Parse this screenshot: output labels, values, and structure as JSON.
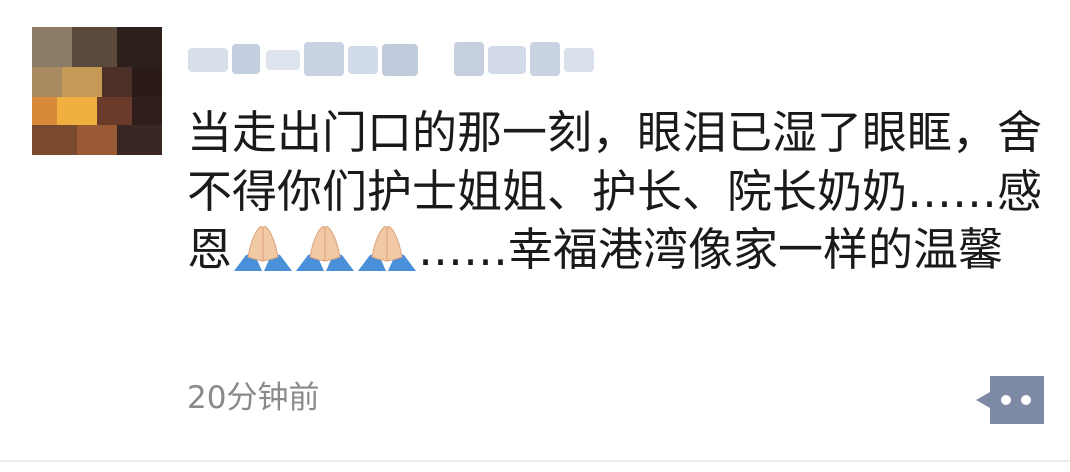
{
  "post": {
    "content_part1": "当走出门口的那一刻，眼泪已湿了眼眶，舍不得你们护士姐姐、护长、院长奶奶……感恩",
    "emojis": [
      "folded-hands-emoji",
      "folded-hands-emoji",
      "folded-hands-emoji"
    ],
    "content_part2": "……幸福港湾像家一样的温馨",
    "timestamp": "20分钟前"
  },
  "icons": {
    "avatar": "avatar-image-blurred",
    "username": "username-blurred",
    "more": "more-options-icon"
  },
  "colors": {
    "text": "#1a1a1a",
    "timestamp": "#8a8a8a",
    "more_button_bg": "#7c8aa6",
    "emoji_skin": "#f1c9a5",
    "emoji_sleeve": "#4a90d9"
  }
}
